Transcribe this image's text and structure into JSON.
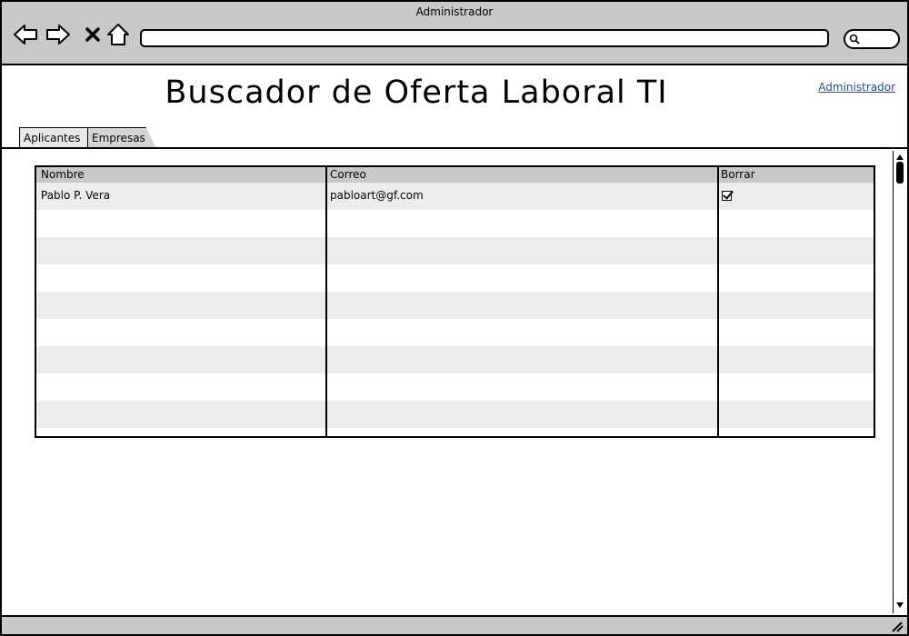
{
  "window": {
    "title": "Administrador"
  },
  "toolbar": {
    "icons": [
      "back-arrow-icon",
      "forward-arrow-icon",
      "close-icon",
      "home-icon"
    ],
    "url_value": "",
    "search_value": ""
  },
  "header": {
    "title": "Buscador de Oferta Laboral TI",
    "user_link": "Administrador"
  },
  "tabs": [
    {
      "label": "Aplicantes"
    },
    {
      "label": "Empresas"
    }
  ],
  "table": {
    "headers": [
      "Nombre",
      "Correo",
      "Borrar"
    ],
    "rows": [
      {
        "nombre": "Pablo P. Vera",
        "correo": "pabloart@gf.com",
        "borrar": true
      }
    ]
  },
  "colors": {
    "chrome": "#c8c8c8",
    "link": "#1a4f9c",
    "row_alt": "#ececec"
  }
}
